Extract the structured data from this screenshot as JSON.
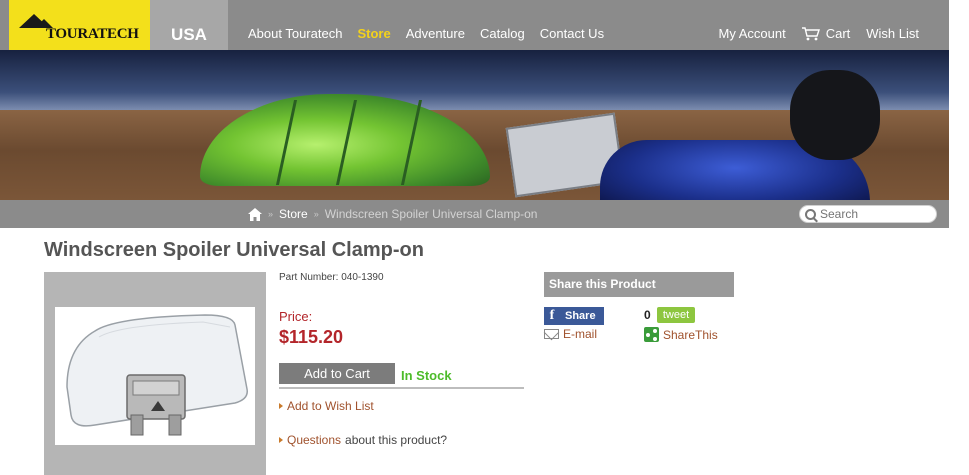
{
  "header": {
    "logo_text": "TOURATECH",
    "region": "USA",
    "nav": [
      "About Touratech",
      "Store",
      "Adventure",
      "Catalog",
      "Contact Us"
    ],
    "active_nav": "Store",
    "account": {
      "my_account": "My Account",
      "cart": "Cart",
      "wish_list": "Wish List"
    }
  },
  "breadcrumb": {
    "store": "Store",
    "current": "Windscreen Spoiler Universal Clamp-on"
  },
  "search": {
    "placeholder": "Search"
  },
  "product": {
    "title": "Windscreen Spoiler Universal Clamp-on",
    "part_number": "Part Number: 040-1390",
    "price_label": "Price:",
    "price": "$115.20",
    "add_to_cart": "Add to Cart",
    "stock": "In Stock",
    "wish_list_link": "Add to Wish List",
    "questions_link": "Questions",
    "questions_rest": "about this product?"
  },
  "share": {
    "heading": "Share this Product",
    "facebook": "Share",
    "email": "E-mail",
    "tweet_count": "0",
    "tweet": "tweet",
    "sharethis": "ShareThis"
  },
  "icons": [
    "home-icon",
    "cart-icon",
    "search-icon",
    "mail-icon",
    "facebook-icon",
    "sharethis-icon"
  ],
  "colors": {
    "brand_yellow": "#f3e01b",
    "header_gray": "#8b8b8b",
    "price_red": "#b3252a",
    "stock_green": "#4dbb2a"
  }
}
